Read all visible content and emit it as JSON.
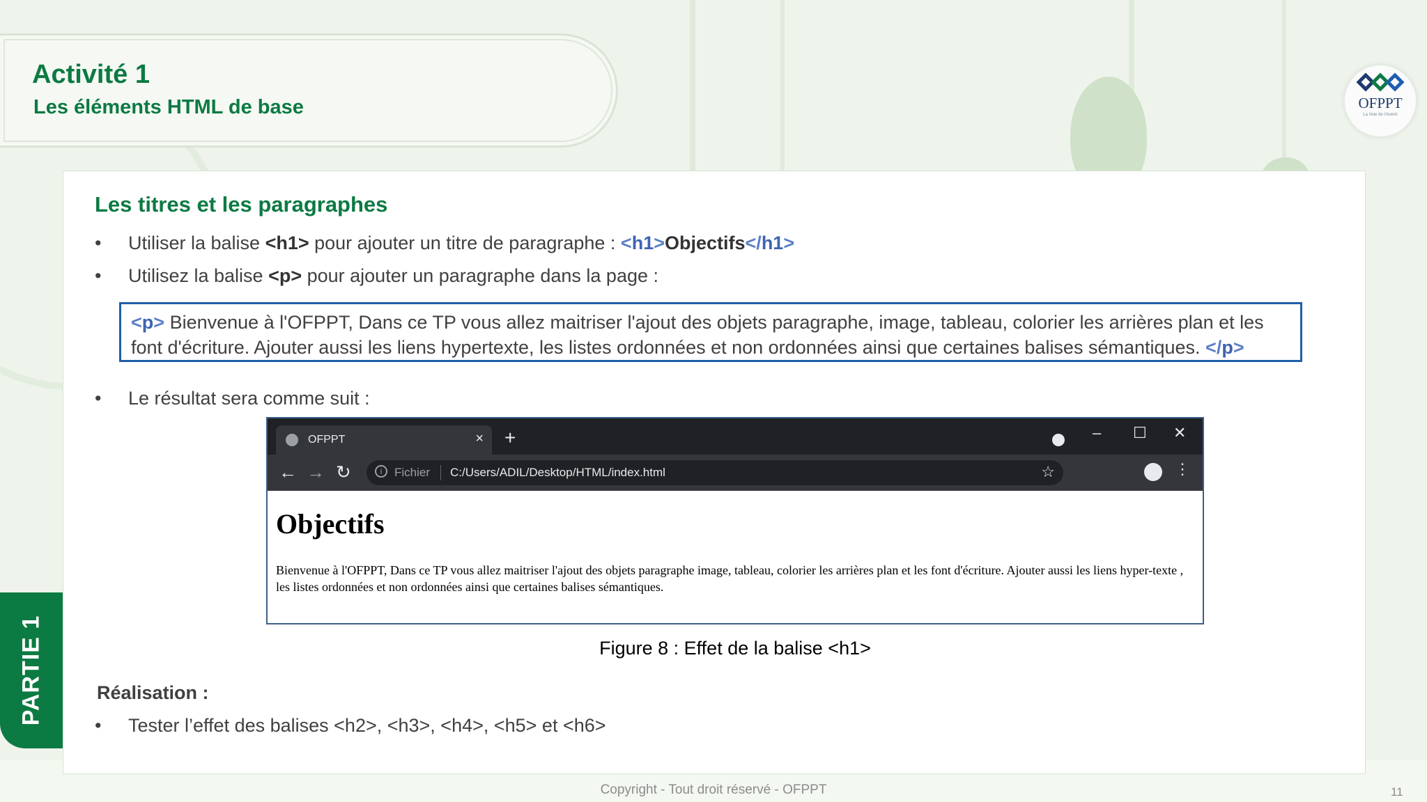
{
  "header": {
    "title": "Activité 1",
    "subtitle": "Les éléments HTML de base"
  },
  "logo": {
    "text": "OFPPT",
    "tagline": "La Voie de l'Avenir"
  },
  "side_tab": {
    "label": "PARTIE 1"
  },
  "section": {
    "title": "Les titres et les paragraphes",
    "bullets": [
      {
        "pre": "Utiliser la balise ",
        "bold": "<h1>",
        "post": " pour ajouter un titre de paragraphe : ",
        "code_open_lt": "<",
        "code_open_name": "h1",
        "code_open_gt": ">",
        "code_text": "Objectifs",
        "code_close_lt": "</",
        "code_close_name": "h1",
        "code_close_gt": ">"
      },
      {
        "pre": "Utilisez la balise ",
        "bold": "<p>",
        "post": " pour ajouter un paragraphe dans la page :"
      }
    ],
    "code_block": {
      "open_lt": "<",
      "open_name": "p",
      "open_gt": ">",
      "text": " Bienvenue à l'OFPPT, Dans ce TP vous allez maitriser l'ajout des objets paragraphe, image, tableau, colorier les arrières plan et les font d'écriture. Ajouter aussi les liens hypertexte, les listes ordonnées et non ordonnées ainsi que certaines balises sémantiques. ",
      "close_lt": "</",
      "close_name": "p",
      "close_gt": ">"
    },
    "result_bullet": "Le résultat sera comme suit :"
  },
  "browser": {
    "tab_title": "OFPPT",
    "tab_close": "×",
    "new_tab": "+",
    "minimize": "–",
    "maximize": "☐",
    "close": "✕",
    "back": "←",
    "forward": "→",
    "reload": "↻",
    "info": "i",
    "fichier_label": "Fichier",
    "url": "C:/Users/ADIL/Desktop/HTML/index.html",
    "star": "☆",
    "menu": "⋮",
    "page_heading": "Objectifs",
    "page_paragraph": "Bienvenue à l'OFPPT, Dans ce TP vous allez maitriser l'ajout des objets paragraphe image, tableau, colorier les arrières plan et les font d'écriture. Ajouter aussi les liens hyper-texte , les listes ordonnées et non ordonnées ainsi que certaines balises sémantiques."
  },
  "caption": "Figure 8 : Effet de la balise <h1>",
  "realisation": {
    "title": "Réalisation :",
    "bullet": "Tester l’effet des balises <h2>, <h3>, <h4>, <h5> et <h6>"
  },
  "footer": "Copyright - Tout droit réservé - OFPPT",
  "page_number": "11",
  "bullet_glyph": "•",
  "colors": {
    "brand_green": "#0c7a43",
    "code_blue": "#3e63b3",
    "box_border": "#1f5fa8"
  }
}
